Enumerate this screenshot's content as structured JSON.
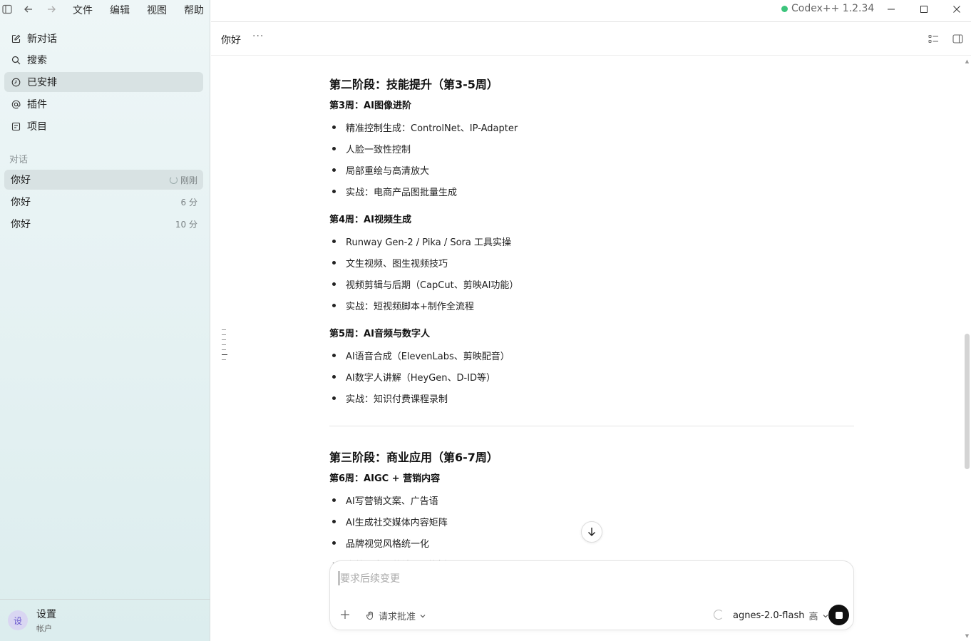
{
  "menu": [
    "文件",
    "编辑",
    "视图",
    "帮助"
  ],
  "app": {
    "version": "Codex++ 1.2.34",
    "status_color": "#3cc47c"
  },
  "sidebar": {
    "nav": [
      {
        "label": "新对话",
        "icon": "edit-icon"
      },
      {
        "label": "搜索",
        "icon": "search-icon"
      },
      {
        "label": "已安排",
        "icon": "clock-icon",
        "active": true
      },
      {
        "label": "插件",
        "icon": "at-icon"
      },
      {
        "label": "项目",
        "icon": "project-icon"
      }
    ],
    "section_label": "对话",
    "conversations": [
      {
        "title": "你好",
        "time": "刚刚",
        "active": true
      },
      {
        "title": "你好",
        "time": "6 分"
      },
      {
        "title": "你好",
        "time": "10 分"
      }
    ],
    "settings": {
      "avatar": "设",
      "title": "设置",
      "subtitle": "帐户"
    }
  },
  "header": {
    "title": "你好",
    "more": "···"
  },
  "content": {
    "phase2": {
      "title": "第二阶段：技能提升（第3-5周）",
      "week3": {
        "title": "第3周：AI图像进阶",
        "items": [
          "精准控制生成：ControlNet、IP-Adapter",
          "人脸一致性控制",
          "局部重绘与高清放大",
          "实战：电商产品图批量生成"
        ]
      },
      "week4": {
        "title": "第4周：AI视频生成",
        "items": [
          "Runway Gen-2 / Pika / Sora 工具实操",
          "文生视频、图生视频技巧",
          "视频剪辑与后期（CapCut、剪映AI功能）",
          "实战：短视频脚本+制作全流程"
        ]
      },
      "week5": {
        "title": "第5周：AI音频与数字人",
        "items": [
          "AI语音合成（ElevenLabs、剪映配音）",
          "AI数字人讲解（HeyGen、D-ID等）",
          "实战：知识付费课程录制"
        ]
      }
    },
    "phase3": {
      "title": "第三阶段：商业应用（第6-7周）",
      "week6": {
        "title": "第6周：AIGC + 营销内容",
        "items": [
          "AI写营销文案、广告语",
          "AI生成社交媒体内容矩阵",
          "品牌视觉风格统一化",
          "实战：自动营销......策划"
        ]
      }
    }
  },
  "composer": {
    "placeholder": "要求后续变更",
    "approval": "请求批准",
    "model": "agnes-2.0-flash",
    "level": "高"
  }
}
